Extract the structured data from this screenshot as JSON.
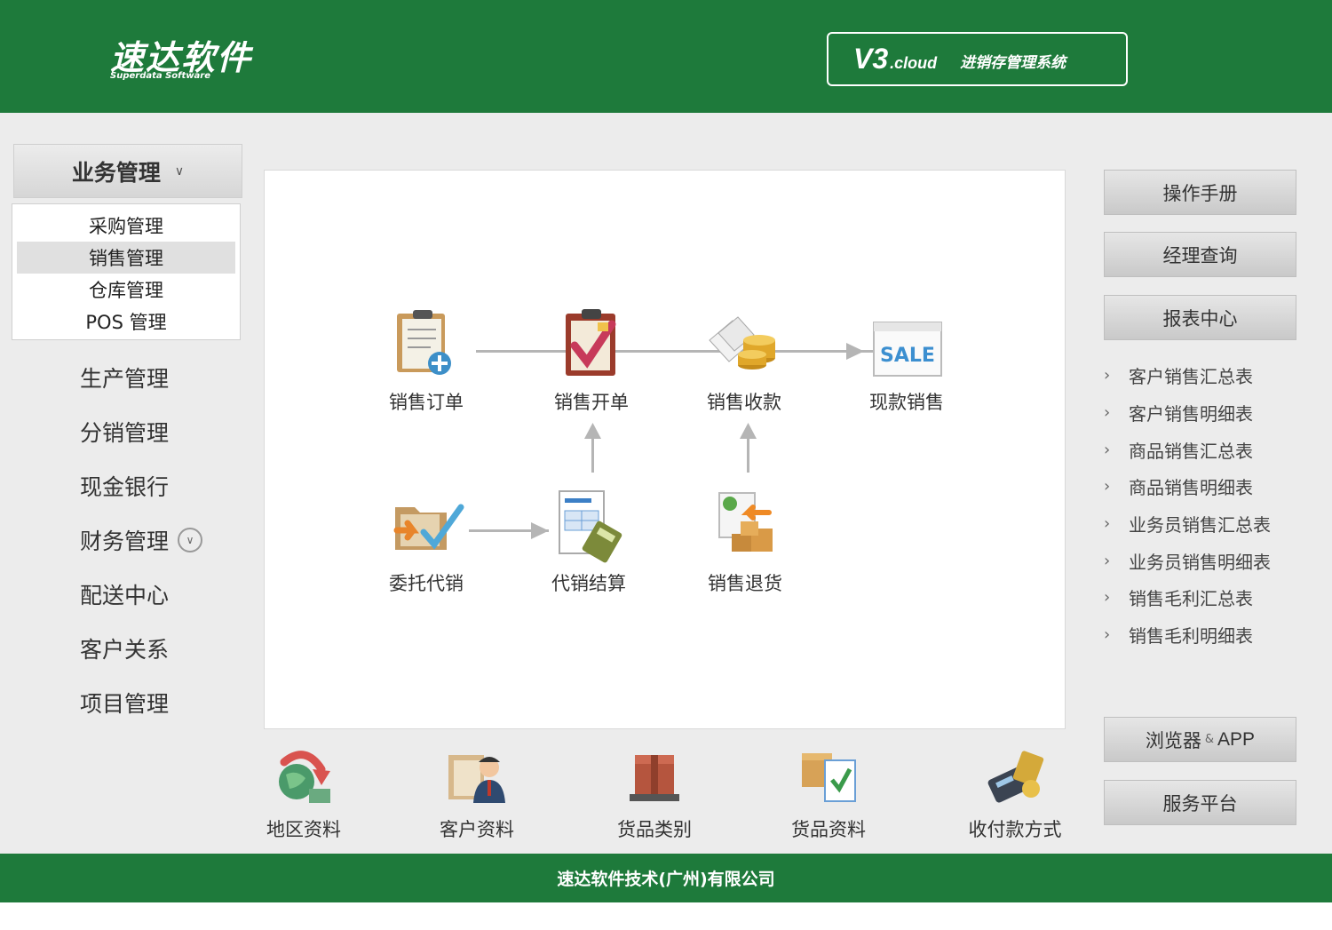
{
  "header": {
    "logo_cn": "速达软件",
    "logo_en": "Superdata Software",
    "version_main": "V3",
    "version_sub": ".cloud",
    "product_name": "进销存管理系统"
  },
  "nav": {
    "head_label": "业务管理",
    "sub_items": [
      "采购管理",
      "销售管理",
      "仓库管理",
      "POS 管理"
    ],
    "active_sub": "销售管理",
    "items": [
      "生产管理",
      "分销管理",
      "现金银行",
      "财务管理",
      "配送中心",
      "客户关系",
      "项目管理"
    ]
  },
  "flow": {
    "sales_order": "销售订单",
    "sales_invoice": "销售开单",
    "sales_receipt": "销售收款",
    "cash_sale": "现款销售",
    "consignment": "委托代销",
    "consignment_settle": "代销结算",
    "sales_return": "销售退货",
    "sale_tag": "SALE"
  },
  "right": {
    "manual": "操作手册",
    "manager_query": "经理查询",
    "report_center": "报表中心",
    "reports": [
      "客户销售汇总表",
      "客户销售明细表",
      "商品销售汇总表",
      "商品销售明细表",
      "业务员销售汇总表",
      "业务员销售明细表",
      "销售毛利汇总表",
      "销售毛利明细表"
    ],
    "browser_app_cn": "浏览器",
    "browser_app_amp": "&",
    "browser_app_en": "APP",
    "service": "服务平台"
  },
  "bottom": {
    "region": "地区资料",
    "customer": "客户资料",
    "goods_category": "货品类别",
    "goods_info": "货品资料",
    "payment": "收付款方式"
  },
  "footer": {
    "company": "速达软件技术(广州)有限公司"
  },
  "colors": {
    "brand_green": "#1e7a3b",
    "panel_bg": "#ececec"
  }
}
